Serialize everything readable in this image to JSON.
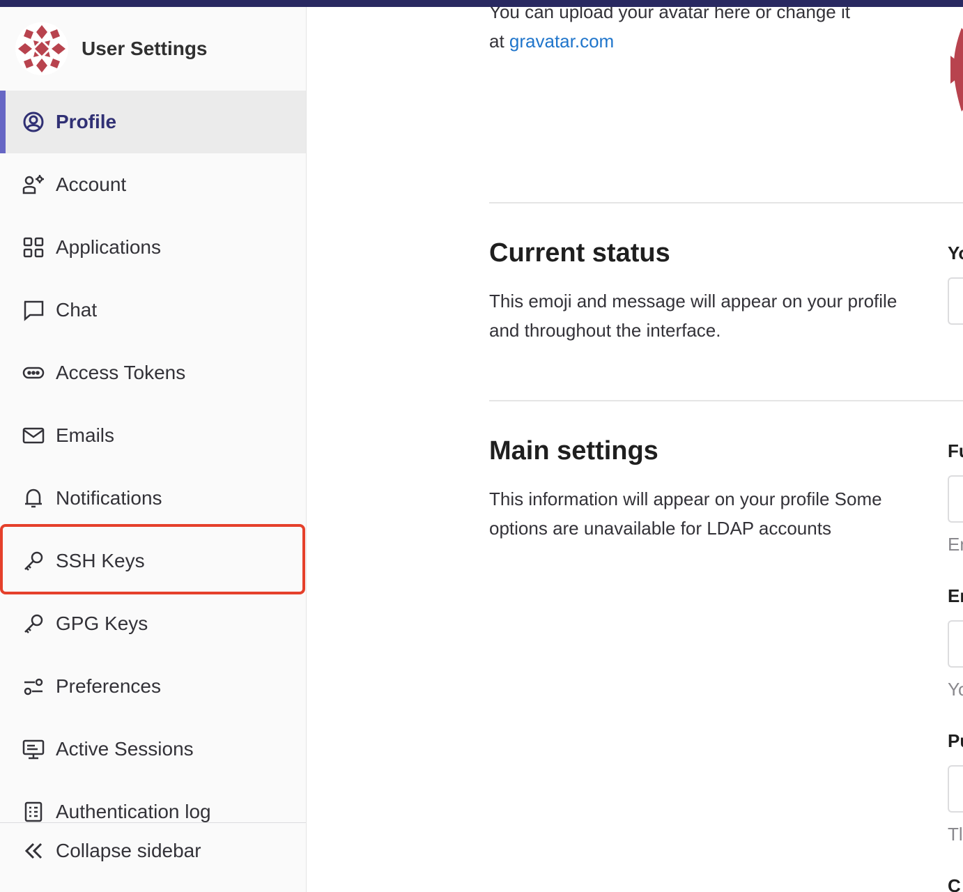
{
  "sidebar": {
    "title": "User Settings",
    "items": [
      {
        "label": "Profile",
        "icon": "profile-icon"
      },
      {
        "label": "Account",
        "icon": "account-icon"
      },
      {
        "label": "Applications",
        "icon": "applications-icon"
      },
      {
        "label": "Chat",
        "icon": "chat-icon"
      },
      {
        "label": "Access Tokens",
        "icon": "token-icon"
      },
      {
        "label": "Emails",
        "icon": "mail-icon"
      },
      {
        "label": "Notifications",
        "icon": "bell-icon"
      },
      {
        "label": "SSH Keys",
        "icon": "key-icon"
      },
      {
        "label": "GPG Keys",
        "icon": "key-icon"
      },
      {
        "label": "Preferences",
        "icon": "preferences-icon"
      },
      {
        "label": "Active Sessions",
        "icon": "monitor-icon"
      },
      {
        "label": "Authentication log",
        "icon": "log-icon"
      }
    ],
    "collapse_label": "Collapse sidebar"
  },
  "main": {
    "upload_text": "You can upload your avatar here or change it",
    "upload_at": "at",
    "gravatar_link": "gravatar.com",
    "current_status": {
      "title": "Current status",
      "description": "This emoji and message will appear on your profile and throughout the interface."
    },
    "main_settings": {
      "title": "Main settings",
      "description": "This information will appear on your profile Some options are unavailable for LDAP accounts"
    },
    "right_column": {
      "status_label": "Yo",
      "full_name_label": "Fu",
      "full_name_help": "En",
      "email_label": "En",
      "email_help": "Yo",
      "public_label": "Pu",
      "public_help": "Tl",
      "next_label": "C"
    }
  },
  "colors": {
    "topbar": "#292961",
    "active_accent": "#6666c4",
    "highlight": "#e5402b",
    "link": "#1f75cb"
  }
}
